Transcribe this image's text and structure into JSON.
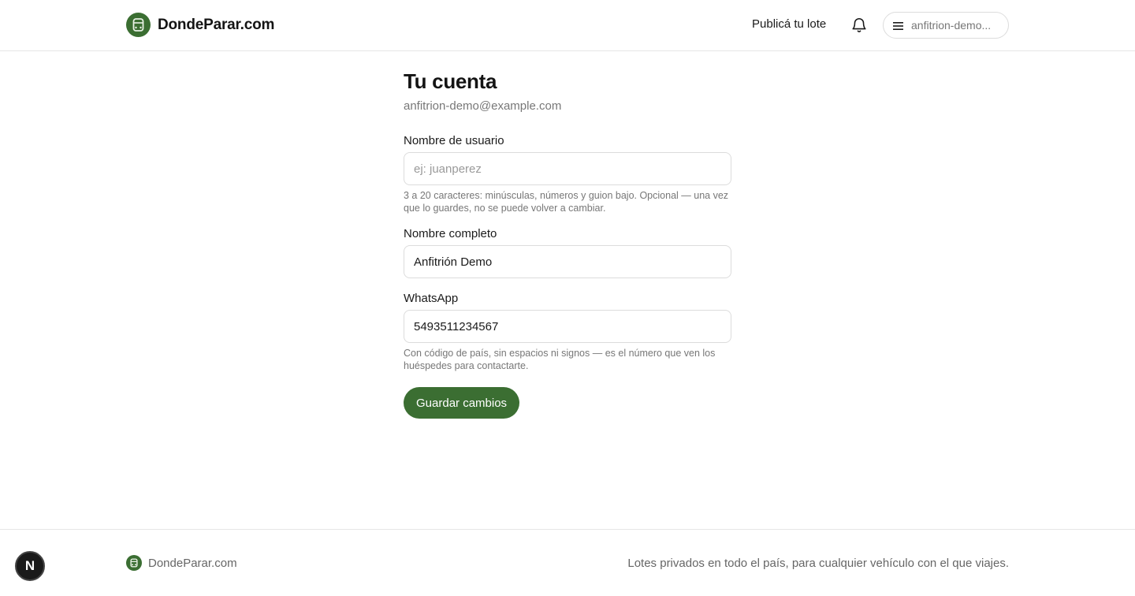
{
  "header": {
    "brand": "DondeParar.com",
    "publish_label": "Publicá tu lote",
    "user_menu_label": "anfitrion-demo..."
  },
  "account": {
    "title": "Tu cuenta",
    "email": "anfitrion-demo@example.com",
    "username": {
      "label": "Nombre de usuario",
      "value": "",
      "placeholder": "ej: juanperez",
      "hint": "3 a 20 caracteres: minúsculas, números y guion bajo. Opcional — una vez que lo guardes, no se puede volver a cambiar."
    },
    "fullname": {
      "label": "Nombre completo",
      "value": "Anfitrión Demo"
    },
    "whatsapp": {
      "label": "WhatsApp",
      "value": "5493511234567",
      "hint": "Con código de país, sin espacios ni signos — es el número que ven los huéspedes para contactarte."
    },
    "save_label": "Guardar cambios"
  },
  "footer": {
    "brand": "DondeParar.com",
    "tagline": "Lotes privados en todo el país, para cualquier vehículo con el que viajes."
  },
  "dev_badge": "N",
  "colors": {
    "brand_green": "#3b6e32",
    "text_muted": "#777777",
    "border": "#dcdcdc"
  },
  "icons": [
    "logo-icon",
    "bell-icon",
    "menu-icon",
    "footer-logo-icon"
  ]
}
